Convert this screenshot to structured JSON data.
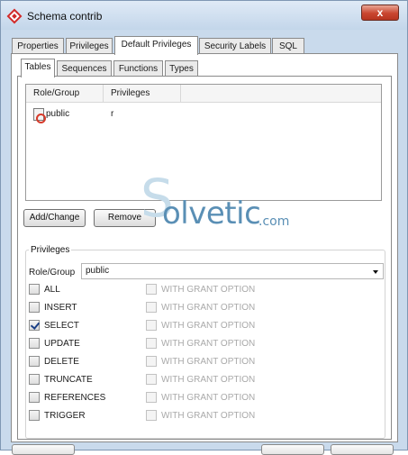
{
  "window": {
    "title": "Schema contrib",
    "close_label": "x"
  },
  "outer_tabs": [
    {
      "label": "Properties"
    },
    {
      "label": "Privileges"
    },
    {
      "label": "Default Privileges"
    },
    {
      "label": "Security Labels"
    },
    {
      "label": "SQL"
    }
  ],
  "outer_active_tab": "Default Privileges",
  "inner_tabs": [
    {
      "label": "Tables"
    },
    {
      "label": "Sequences"
    },
    {
      "label": "Functions"
    },
    {
      "label": "Types"
    }
  ],
  "inner_active_tab": "Tables",
  "list": {
    "columns": [
      "Role/Group",
      "Privileges"
    ],
    "rows": [
      {
        "role": "public",
        "privileges": "r"
      }
    ]
  },
  "buttons": {
    "add_change": "Add/Change",
    "remove": "Remove"
  },
  "privileges_group": {
    "label": "Privileges",
    "role_group_label": "Role/Group",
    "role_group_value": "public",
    "items": [
      {
        "label": "ALL",
        "checked": false,
        "grant_label": "WITH GRANT OPTION"
      },
      {
        "label": "INSERT",
        "checked": false,
        "grant_label": "WITH GRANT OPTION"
      },
      {
        "label": "SELECT",
        "checked": true,
        "grant_label": "WITH GRANT OPTION"
      },
      {
        "label": "UPDATE",
        "checked": false,
        "grant_label": "WITH GRANT OPTION"
      },
      {
        "label": "DELETE",
        "checked": false,
        "grant_label": "WITH GRANT OPTION"
      },
      {
        "label": "TRUNCATE",
        "checked": false,
        "grant_label": "WITH GRANT OPTION"
      },
      {
        "label": "REFERENCES",
        "checked": false,
        "grant_label": "WITH GRANT OPTION"
      },
      {
        "label": "TRIGGER",
        "checked": false,
        "grant_label": "WITH GRANT OPTION"
      }
    ]
  },
  "watermark": {
    "mark": "S",
    "text": "olvetic",
    "suffix": ".com"
  },
  "colors": {
    "accent": "#d02a2a",
    "window_frame": "#c9daec",
    "watermark": "#5a8fb5"
  }
}
